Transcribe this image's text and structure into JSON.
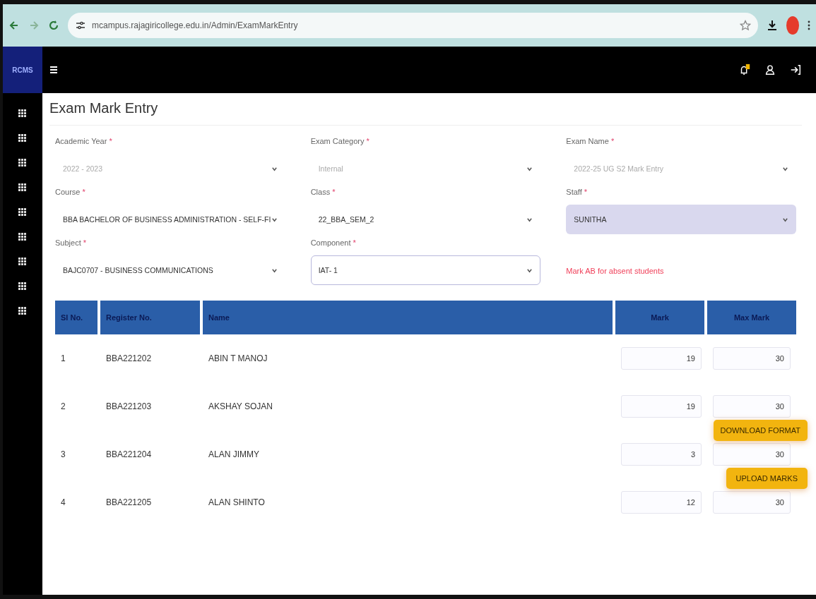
{
  "browser": {
    "url": "mcampus.rajagiricollege.edu.in/Admin/ExamMarkEntry"
  },
  "app": {
    "logo": "RCMS"
  },
  "page": {
    "title": "Exam Mark Entry"
  },
  "fields": [
    {
      "label": "Academic Year",
      "required_mark": "*",
      "value": "2022 - 2023",
      "disabled": true,
      "highlighted": false,
      "focused": false
    },
    {
      "label": "Exam Category",
      "required_mark": "*",
      "value": "Internal",
      "disabled": true,
      "highlighted": false,
      "focused": false
    },
    {
      "label": "Exam Name",
      "required_mark": "*",
      "value": "2022-25 UG S2 Mark Entry",
      "disabled": true,
      "highlighted": false,
      "focused": false
    },
    {
      "label": "Course",
      "required_mark": "*",
      "value": "BBA BACHELOR OF BUSINESS ADMINISTRATION - SELF-FI",
      "disabled": false,
      "highlighted": false,
      "focused": false
    },
    {
      "label": "Class",
      "required_mark": "*",
      "value": "22_BBA_SEM_2",
      "disabled": false,
      "highlighted": false,
      "focused": false
    },
    {
      "label": "Staff",
      "required_mark": "*",
      "value": "SUNITHA",
      "disabled": false,
      "highlighted": true,
      "focused": false
    },
    {
      "label": "Subject",
      "required_mark": "*",
      "value": "BAJC0707 - BUSINESS COMMUNICATIONS",
      "disabled": false,
      "highlighted": false,
      "focused": false
    },
    {
      "label": "Component",
      "required_mark": "*",
      "value": "IAT- 1",
      "disabled": false,
      "highlighted": false,
      "focused": true
    }
  ],
  "note": "Mark AB for absent students",
  "table": {
    "columns": [
      "Sl No.",
      "Register No.",
      "Name",
      "Mark",
      "Max Mark"
    ],
    "rows": [
      {
        "sl_no": "1",
        "register_no": "BBA221202",
        "name": "ABIN T MANOJ",
        "mark": "19",
        "max_mark": "30"
      },
      {
        "sl_no": "2",
        "register_no": "BBA221203",
        "name": "AKSHAY SOJAN",
        "mark": "19",
        "max_mark": "30"
      },
      {
        "sl_no": "3",
        "register_no": "BBA221204",
        "name": "ALAN JIMMY",
        "mark": "3",
        "max_mark": "30"
      },
      {
        "sl_no": "4",
        "register_no": "BBA221205",
        "name": "ALAN SHINTO",
        "mark": "12",
        "max_mark": "30"
      }
    ]
  },
  "actions": [
    "DOWNLOAD FORMAT",
    "UPLOAD MARKS"
  ]
}
